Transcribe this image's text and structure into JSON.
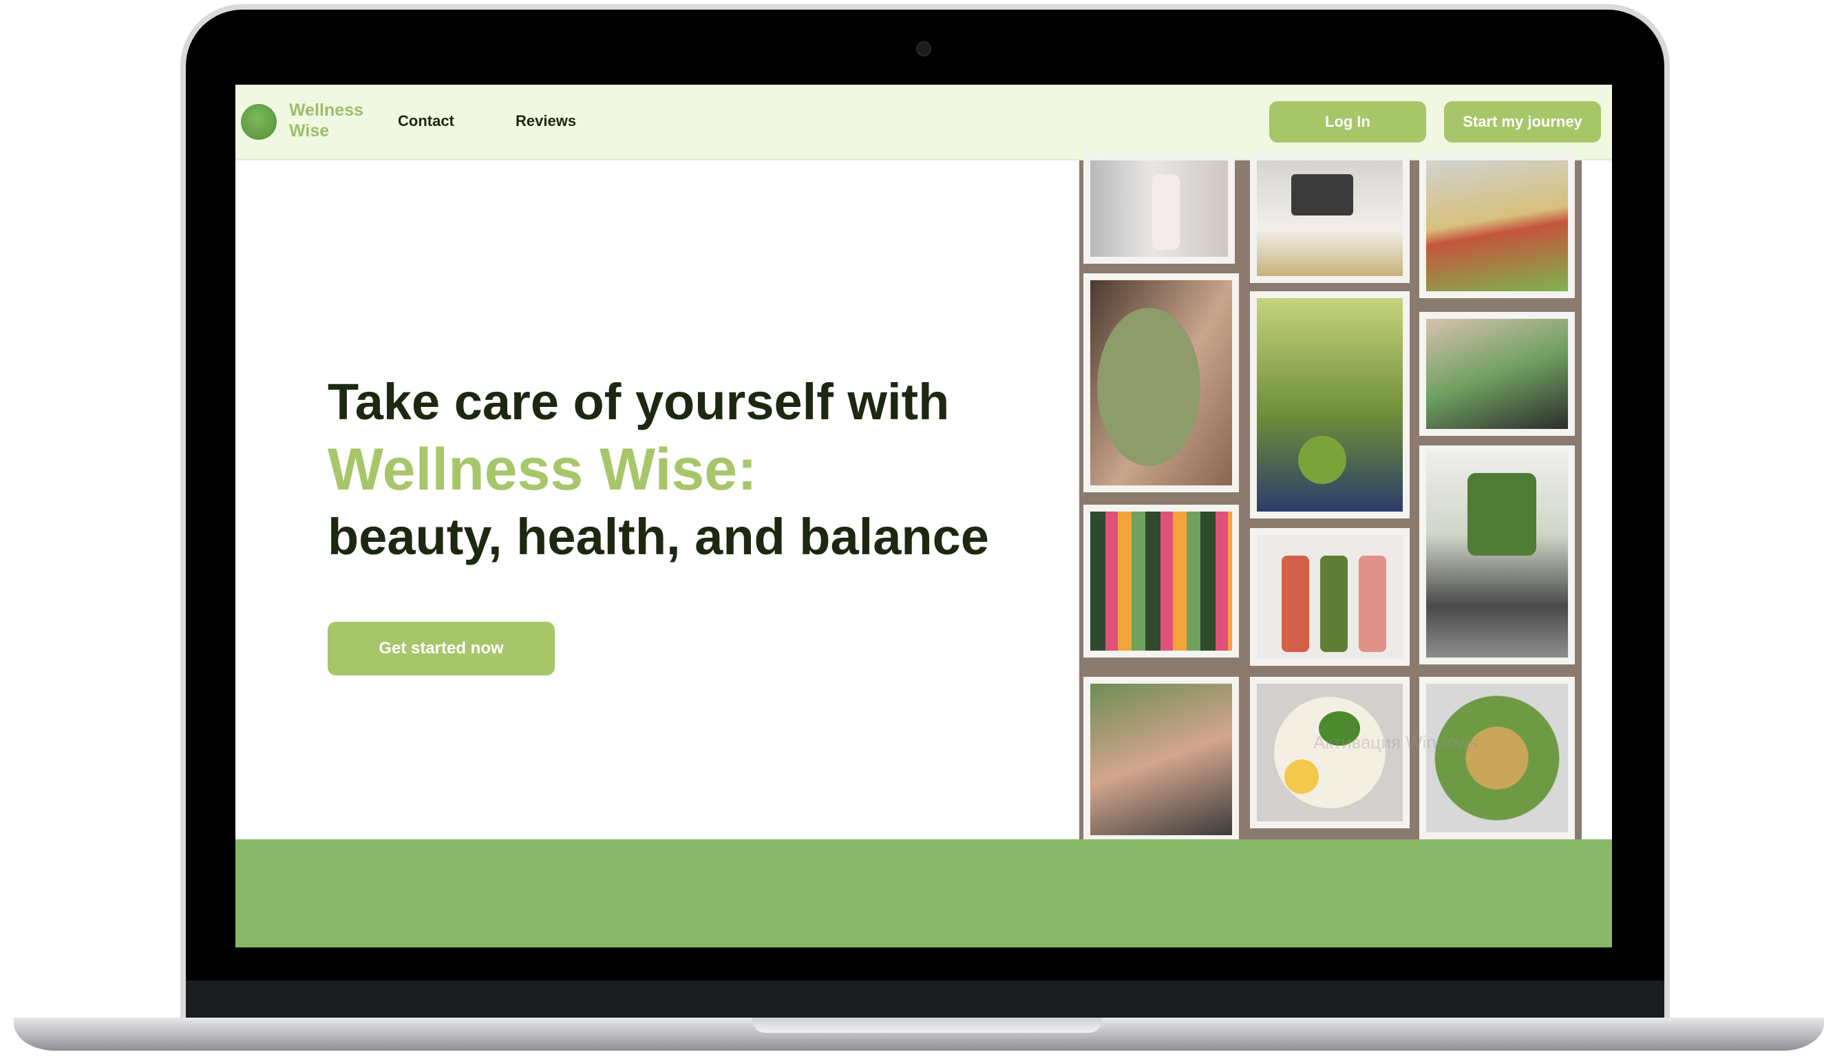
{
  "brand": {
    "name_line1": "Wellness",
    "name_line2": "Wise",
    "colors": {
      "accent": "#a7c66a",
      "nav_bg": "#f1f8e2",
      "headline": "#1c2810",
      "band": "#89b76a"
    }
  },
  "nav": {
    "links": [
      "Contact",
      "Reviews"
    ],
    "login_label": "Log In",
    "journey_label": "Start my journey"
  },
  "hero": {
    "line1": "Take care of yourself with",
    "line2": "Wellness Wise:",
    "line3": "beauty, health, and balance",
    "cta_label": "Get started now"
  },
  "collage": {
    "photos": [
      "water-bottle-photo",
      "laptop-breakfast-photo",
      "sandwich-photo",
      "face-mask-photo",
      "smoothie-fruit-bowl-photo",
      "green-smoothie-photo",
      "juice-shelf-photo",
      "blender-photo",
      "juice-bottles-photo",
      "smoothie-cup-photo",
      "salad-bowl-egg-photo",
      "caesar-salad-photo"
    ]
  },
  "watermark": {
    "line1": "Активация Windows"
  }
}
